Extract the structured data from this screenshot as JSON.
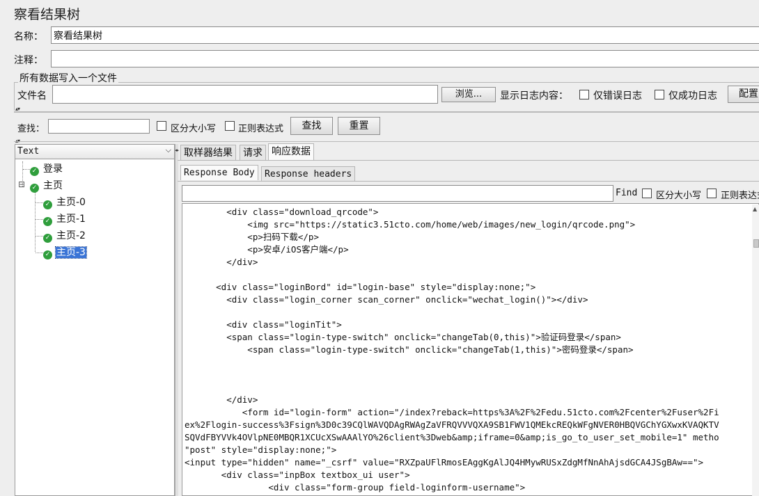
{
  "window_title": "察看结果树",
  "name": {
    "label": "名称：",
    "value": "察看结果树"
  },
  "comment": {
    "label": "注释：",
    "value": ""
  },
  "file_group": {
    "legend": "所有数据写入一个文件",
    "filename_label": "文件名",
    "filename_value": "",
    "browse_label": "浏览...",
    "log_content_label": "显示日志内容：",
    "errors_only_label": "仅错误日志",
    "success_only_label": "仅成功日志",
    "config_label": "配置"
  },
  "search": {
    "label": "查找：",
    "value": "",
    "case_sensitive_label": "区分大小写",
    "regex_label": "正则表达式",
    "find_button": "查找",
    "reset_button": "重置"
  },
  "renderer": {
    "selected": "Text"
  },
  "tree": {
    "items": [
      {
        "label": "登录",
        "level": 0,
        "status": "success"
      },
      {
        "label": "主页",
        "level": 0,
        "status": "success",
        "expanded": true
      },
      {
        "label": "主页-0",
        "level": 1,
        "status": "success"
      },
      {
        "label": "主页-1",
        "level": 1,
        "status": "success"
      },
      {
        "label": "主页-2",
        "level": 1,
        "status": "success"
      },
      {
        "label": "主页-3",
        "level": 1,
        "status": "success",
        "selected": true
      }
    ],
    "expand_symbol": "⊟"
  },
  "tabs": [
    {
      "label": "取样器结果",
      "active": false
    },
    {
      "label": "请求",
      "active": false
    },
    {
      "label": "响应数据",
      "active": true
    }
  ],
  "subtabs": [
    {
      "label": "Response Body",
      "active": true
    },
    {
      "label": "Response headers",
      "active": false
    }
  ],
  "body_find": {
    "value": "",
    "find_label": "Find",
    "case_label": "区分大小写",
    "regex_label": "正则表达式"
  },
  "response_lines": [
    "        <div class=\"download_qrcode\">",
    "            <img src=\"https://static3.51cto.com/home/web/images/new_login/qrcode.png\">",
    "            <p>扫码下载</p>",
    "            <p>安卓/iOS客户端</p>",
    "        </div>",
    "",
    "      <div class=\"loginBord\" id=\"login-base\" style=\"display:none;\">",
    "        <div class=\"login_corner scan_corner\" onclick=\"wechat_login()\"></div>",
    "",
    "        <div class=\"loginTit\">",
    "        <span class=\"login-type-switch\" onclick=\"changeTab(0,this)\">验证码登录</span>",
    "            <span class=\"login-type-switch\" onclick=\"changeTab(1,this)\">密码登录</span>",
    "",
    "",
    "",
    "        </div>",
    "           <form id=\"login-form\" action=\"/index?reback=https%3A%2F%2Fedu.51cto.com%2Fcenter%2Fuser%2Fi",
    "ex%2Flogin-success%3Fsign%3D0c39CQlWAVQDAgRWAgZaVFRQVVVQXA9SB1FWV1QMEkcREQkWFgNVER0HBQVGChYGXwxKVAQKTV",
    "SQVdFBYVVk4OVlpNE0MBQR1XCUcXSwAAAlYO%26client%3Dweb&amp;iframe=0&amp;is_go_to_user_set_mobile=1\" metho",
    "\"post\" style=\"display:none;\">",
    "<input type=\"hidden\" name=\"_csrf\" value=\"RXZpaUFlRmosEAggKgAlJQ4HMywRUSxZdgMfNnAhAjsdGCA4JSgBAw==\">",
    "       <div class=\"inpBox textbox_ui user\">",
    "                <div class=\"form-group field-loginform-username\">"
  ]
}
